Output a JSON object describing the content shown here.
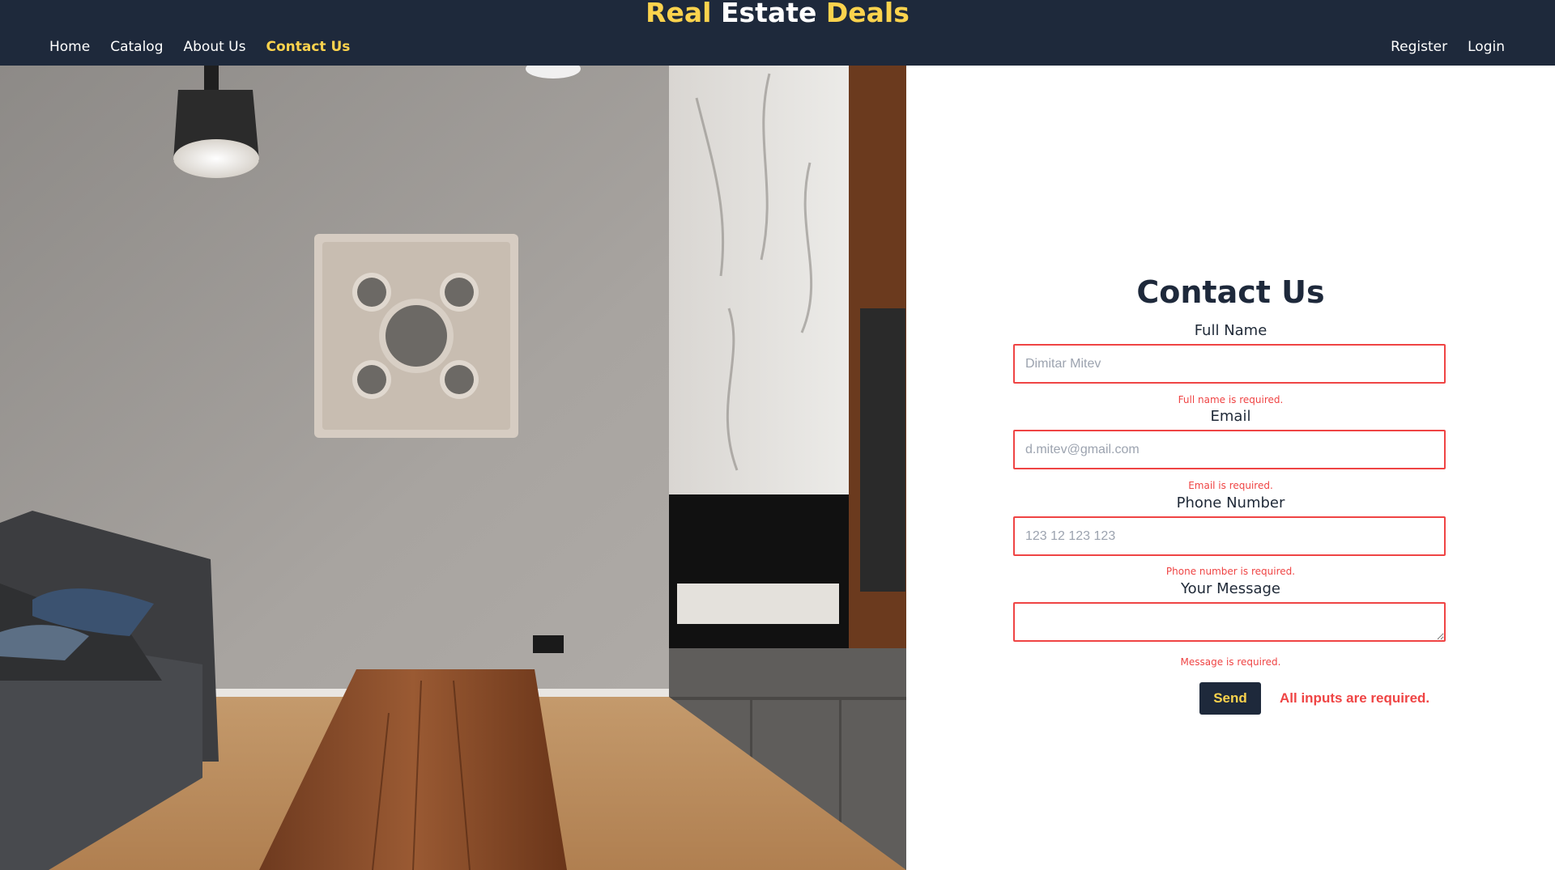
{
  "brand": {
    "part1": "Real",
    "part2": "Estate",
    "part3": "Deals"
  },
  "nav": {
    "home": "Home",
    "catalog": "Catalog",
    "about": "About Us",
    "contact": "Contact Us",
    "register": "Register",
    "login": "Login"
  },
  "form": {
    "title": "Contact Us",
    "full_name": {
      "label": "Full Name",
      "placeholder": "Dimitar Mitev",
      "value": "",
      "error": "Full name is required."
    },
    "email": {
      "label": "Email",
      "placeholder": "d.mitev@gmail.com",
      "value": "",
      "error": "Email is required."
    },
    "phone": {
      "label": "Phone Number",
      "placeholder": "123 12 123 123",
      "value": "",
      "error": "Phone number is required."
    },
    "message": {
      "label": "Your Message",
      "placeholder": "",
      "value": "",
      "error": "Message is required."
    },
    "send_label": "Send",
    "global_error": "All inputs are required."
  },
  "colors": {
    "header_bg": "#1e293b",
    "accent_yellow": "#fcd34d",
    "error_red": "#ef4444"
  }
}
